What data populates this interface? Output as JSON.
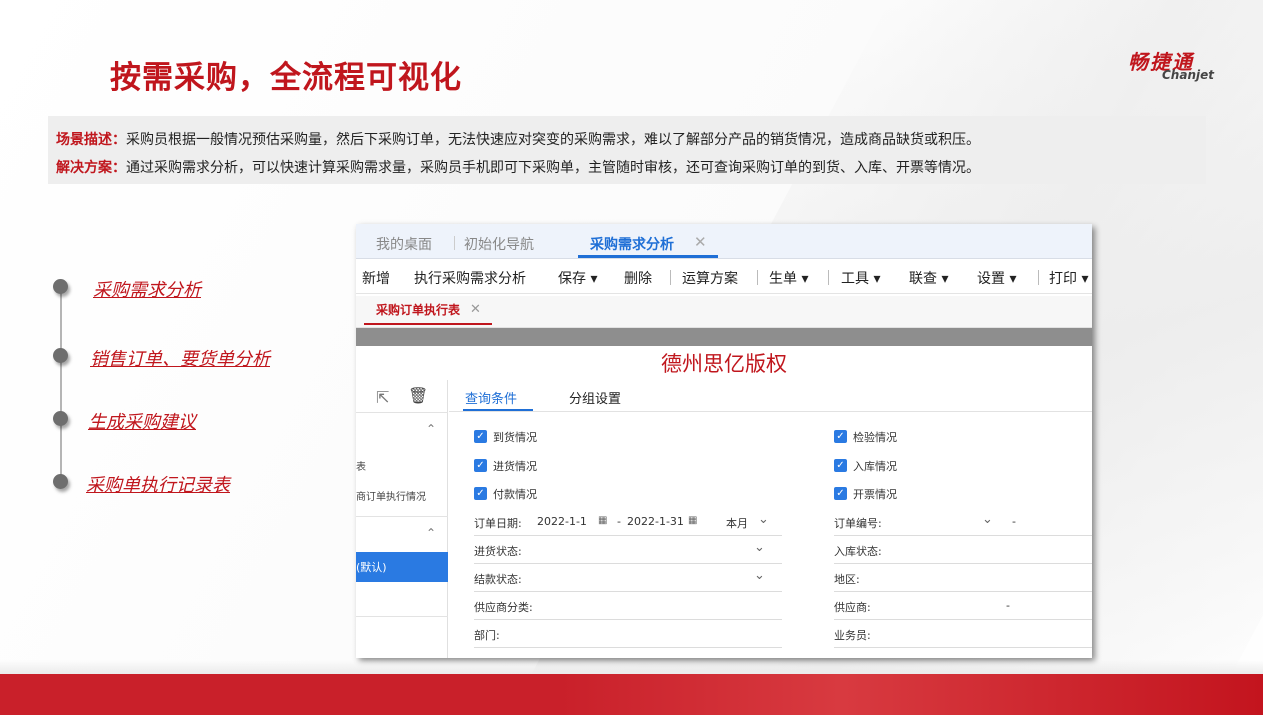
{
  "slide": {
    "title": "按需采购，全流程可视化",
    "brand_cn": "畅捷通",
    "brand_en": "Chanjet",
    "accent_color": "#c0161d"
  },
  "description": {
    "scene_label": "场景描述：",
    "scene_text": "采购员根据一般情况预估采购量，然后下采购订单，无法快速应对突变的采购需求，难以了解部分产品的销货情况，造成商品缺货或积压。",
    "solution_label": "解决方案：",
    "solution_text": "通过采购需求分析，可以快速计算采购需求量，采购员手机即可下采购单，主管随时审核，还可查询采购订单的到货、入库、开票等情况。"
  },
  "timeline": [
    {
      "label": "采购需求分析"
    },
    {
      "label": "销售订单、要货单分析"
    },
    {
      "label": "生成采购建议"
    },
    {
      "label": "采购单执行记录表"
    }
  ],
  "app": {
    "tabs": [
      {
        "label": "我的桌面"
      },
      {
        "label": "初始化导航"
      },
      {
        "label": "采购需求分析"
      }
    ],
    "tab_close": "✕",
    "toolbar": [
      {
        "label": "新增"
      },
      {
        "label": "执行采购需求分析"
      },
      {
        "label": "保存 ▾"
      },
      {
        "label": "删除"
      },
      {
        "label": "运算方案"
      },
      {
        "label": "生单 ▾"
      },
      {
        "label": "工具 ▾"
      },
      {
        "label": "联查 ▾"
      },
      {
        "label": "设置 ▾"
      },
      {
        "label": "打印 ▾"
      }
    ],
    "subtab": {
      "label": "采购订单执行表",
      "close": "✕"
    },
    "report_heading": "德州思亿版权",
    "left_panel": {
      "item1": "表",
      "item2": "商订单执行情况",
      "selected": "(默认)"
    },
    "filter_tabs": [
      {
        "label": "查询条件"
      },
      {
        "label": "分组设置"
      }
    ],
    "checkboxes_left": [
      {
        "label": "到货情况",
        "checked": true
      },
      {
        "label": "进货情况",
        "checked": true
      },
      {
        "label": "付款情况",
        "checked": true
      }
    ],
    "checkboxes_right": [
      {
        "label": "检验情况",
        "checked": true
      },
      {
        "label": "入库情况",
        "checked": true
      },
      {
        "label": "开票情况",
        "checked": true
      }
    ],
    "fields_left": {
      "order_date_label": "订单日期:",
      "date_from": "2022-1-1",
      "date_sep": "-",
      "date_to": "2022-1-31",
      "period": "本月",
      "arrival_status": "进货状态:",
      "settle_status": "结款状态:",
      "supplier_class": "供应商分类:",
      "department": "部门:"
    },
    "fields_right": {
      "order_no": "订单编号:",
      "order_no_sep": "-",
      "stock_status": "入库状态:",
      "region": "地区:",
      "supplier": "供应商:",
      "supplier_sep": "-",
      "salesman": "业务员:"
    },
    "active_color": "#1f6fd6"
  }
}
